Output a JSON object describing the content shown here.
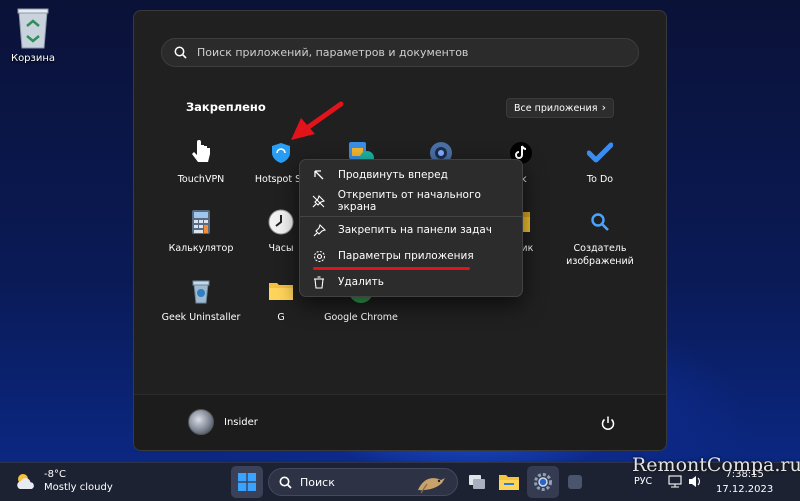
{
  "desktop": {
    "recycle_bin_label": "Корзина"
  },
  "start_menu": {
    "search_placeholder": "Поиск приложений, параметров и документов",
    "pinned_title": "Закреплено",
    "all_apps_label": "Все приложения",
    "all_apps_chevron": "›",
    "apps": [
      {
        "label": "TouchVPN",
        "icon": "hand-pointer-icon"
      },
      {
        "label": "Hotspot Sh",
        "icon": "hotspot-shield-icon"
      },
      {
        "label": "",
        "icon": "photos-edge-icon"
      },
      {
        "label": "",
        "icon": "camera-icon"
      },
      {
        "label": "ok",
        "icon": "tiktok-icon"
      },
      {
        "label": "To Do",
        "icon": "todo-check-icon"
      },
      {
        "label": "Калькулятор",
        "icon": "calculator-icon"
      },
      {
        "label": "Часы",
        "icon": "clock-icon"
      },
      {
        "label": "дник",
        "icon": "notes-icon"
      },
      {
        "label": "Создатель изображений",
        "icon": "image-creator-icon"
      },
      {
        "label": "Geek Uninstaller",
        "icon": "geek-uninstaller-icon"
      },
      {
        "label": "G",
        "icon": "folder-icon"
      },
      {
        "label": "Google Chrome",
        "icon": "chrome-icon"
      }
    ],
    "user_name": "Insider"
  },
  "context_menu": {
    "items": [
      {
        "label": "Продвинуть вперед",
        "icon": "arrow-up-left-icon"
      },
      {
        "label": "Открепить от начального экрана",
        "icon": "unpin-icon"
      },
      {
        "label": "Закрепить на панели задач",
        "icon": "pin-icon"
      },
      {
        "label": "Параметры приложения",
        "icon": "gear-icon"
      },
      {
        "label": "Удалить",
        "icon": "trash-icon"
      }
    ]
  },
  "taskbar": {
    "weather_temp": "-8°C",
    "weather_desc": "Mostly cloudy",
    "search_label": "Поиск",
    "language": "РУС",
    "time": "7:38:15",
    "date": "17.12.2023"
  },
  "watermark": "RemontCompa.ru",
  "colors": {
    "accent": "#0078d4",
    "highlight_underline": "#e2131b",
    "arrow": "#e2131b"
  }
}
